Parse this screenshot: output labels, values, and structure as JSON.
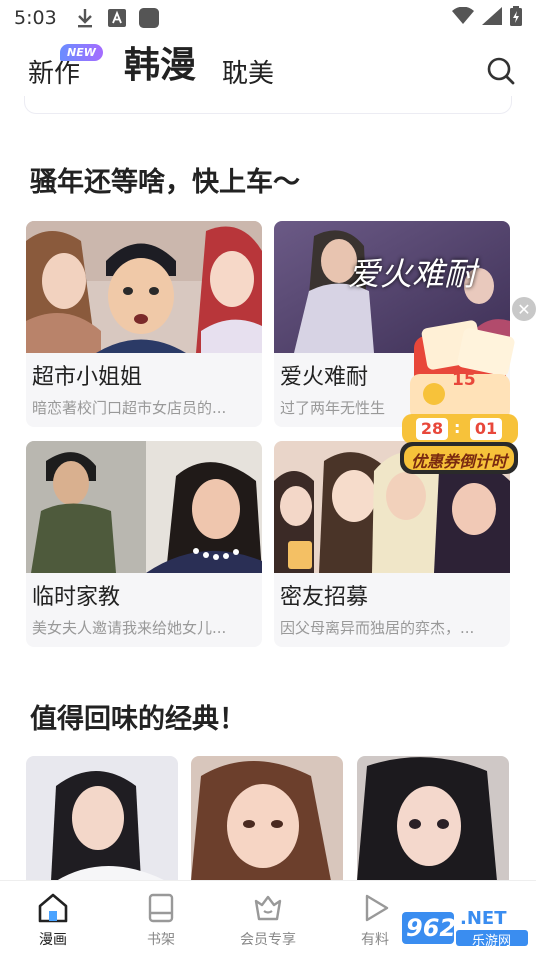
{
  "status_bar": {
    "time": "5:03"
  },
  "top_tabs": {
    "new_label": "新作",
    "new_badge": "NEW",
    "korean_label": "韩漫",
    "bl_label": "耽美"
  },
  "sections": [
    {
      "title": "骚年还等啥，快上车～",
      "cards": [
        {
          "title": "超市小姐姐",
          "desc": "暗恋著校门口超市女店员的..."
        },
        {
          "title": "爱火难耐",
          "desc": "过了两年无性生",
          "cover_text": "爱火难耐"
        },
        {
          "title": "临时家教",
          "desc": "美女夫人邀请我来给她女儿..."
        },
        {
          "title": "密友招募",
          "desc": "因父母离异而独居的弈杰，..."
        }
      ]
    },
    {
      "title": "值得回味的经典！"
    }
  ],
  "coupon": {
    "hour": "28",
    "minute": "01",
    "amount": "15",
    "label": "优惠券倒计时"
  },
  "bottom_nav": [
    {
      "label": "漫画"
    },
    {
      "label": "书架"
    },
    {
      "label": "会员专享"
    },
    {
      "label": "有料"
    }
  ],
  "watermark": {
    "number": "962",
    "suffix": ".NET",
    "text": "乐游网"
  },
  "colors": {
    "accent": "#2b2b2b",
    "badge": "#7b7cff",
    "coupon_red": "#e8473a",
    "coupon_gold": "#f7c23a"
  }
}
